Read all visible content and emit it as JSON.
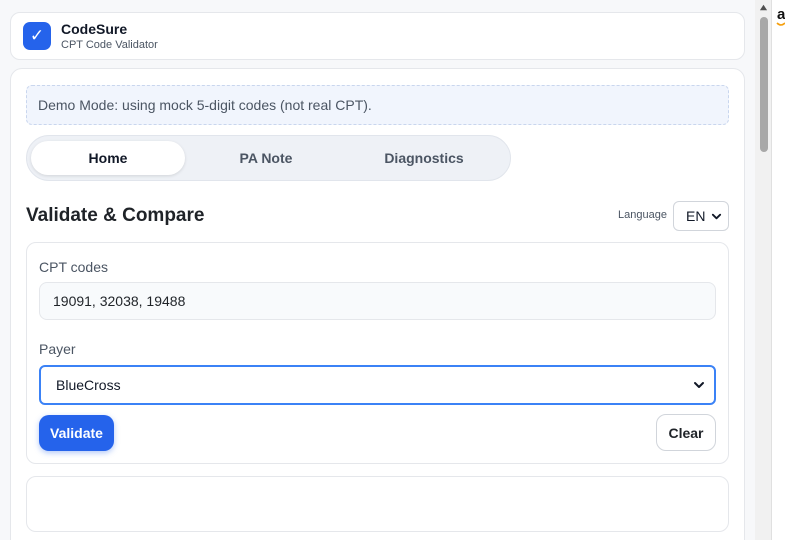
{
  "app": {
    "title": "CodeSure",
    "subtitle": "CPT Code Validator",
    "logo_icon": "checkmark-icon",
    "logo_glyph": "✓",
    "accent": "#2563eb"
  },
  "banner": {
    "text": "Demo Mode: using mock 5-digit codes (not real CPT)."
  },
  "tabs": [
    {
      "label": "Home",
      "active": true
    },
    {
      "label": "PA Note",
      "active": false
    },
    {
      "label": "Diagnostics",
      "active": false
    }
  ],
  "section": {
    "title": "Validate & Compare"
  },
  "language": {
    "label": "Language",
    "selected": "EN"
  },
  "form": {
    "cpt_label": "CPT codes",
    "cpt_value": "19091, 32038, 19488",
    "payer_label": "Payer",
    "payer_selected": "BlueCross",
    "validate_label": "Validate",
    "clear_label": "Clear"
  },
  "side": {
    "glyph": "a"
  }
}
